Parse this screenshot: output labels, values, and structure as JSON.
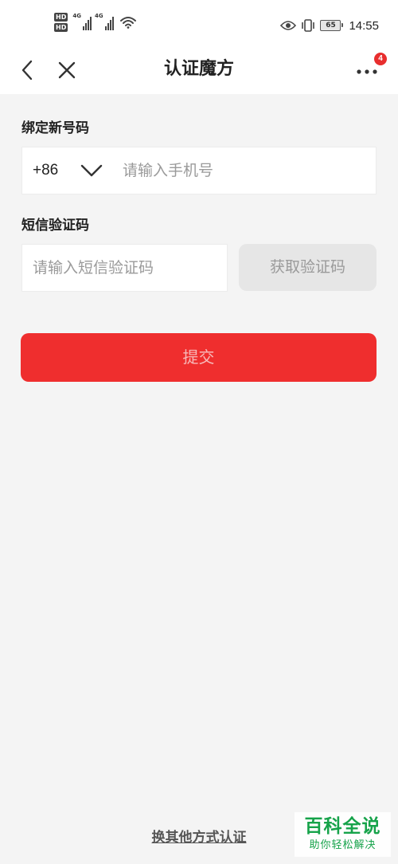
{
  "status_bar": {
    "hd_badges": [
      "HD",
      "HD"
    ],
    "network_tags": [
      "4G",
      "4G"
    ],
    "battery_level": "65",
    "time": "14:55",
    "icons": [
      "signal-icon",
      "wifi-icon",
      "eye-icon",
      "vibrate-icon",
      "battery-icon"
    ]
  },
  "nav": {
    "title": "认证魔方",
    "notification_count": "4",
    "icons": [
      "back-arrow-icon",
      "close-icon",
      "more-icon"
    ]
  },
  "form": {
    "phone_section_label": "绑定新号码",
    "country_code": "+86",
    "phone_placeholder": "请输入手机号",
    "phone_value": "",
    "sms_section_label": "短信验证码",
    "sms_placeholder": "请输入短信验证码",
    "sms_value": "",
    "get_code_label": "获取验证码",
    "submit_label": "提交"
  },
  "footer": {
    "alt_method_label": "换其他方式认证"
  },
  "watermark": {
    "main": "百科全说",
    "sub": "助你轻松解决"
  },
  "colors": {
    "accent_red": "#ef2e2e",
    "background": "#f4f4f4",
    "disabled_button": "#e6e6e6",
    "watermark_green": "#16a34a"
  }
}
